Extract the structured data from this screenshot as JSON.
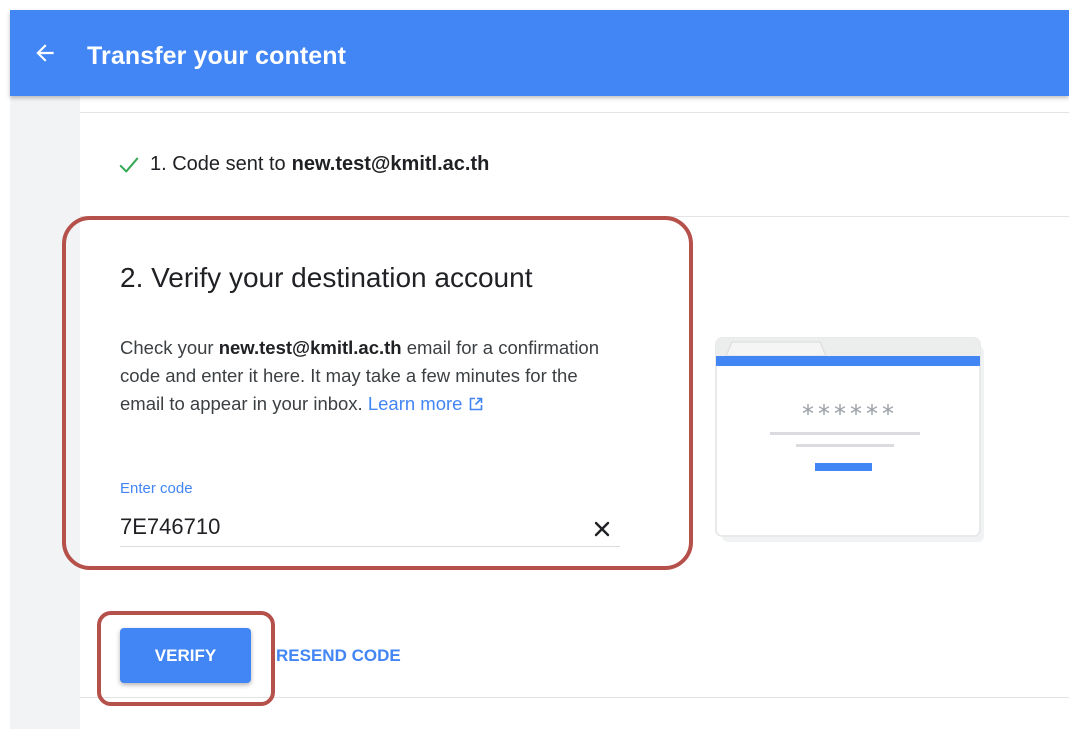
{
  "header": {
    "title": "Transfer your content",
    "back_icon": "arrow-back-icon",
    "bar_color": "#4285f4"
  },
  "step1": {
    "text": "1. Code sent to",
    "email": "new.test@kmitl.ac.th",
    "status_icon": "check-icon",
    "status_color": "#34a853"
  },
  "step2": {
    "title": "2. Verify your destination account",
    "description_prefix": "Check your",
    "email": "new.test@kmitl.ac.th",
    "description_suffix": "email for a confirmation code and enter it here. It may take a few minutes for the email to appear in your inbox.",
    "learn_more": "Learn more",
    "external_icon": "open-in-new-icon"
  },
  "code_field": {
    "label": "Enter code",
    "value": "7E746710",
    "clear_icon": "close-icon"
  },
  "illustration": {
    "masked_text": "******"
  },
  "actions": {
    "verify_label": "VERIFY",
    "resend_label": "RESEND CODE"
  },
  "colors": {
    "accent": "#4285f4",
    "highlight_outline": "#b5504a"
  }
}
